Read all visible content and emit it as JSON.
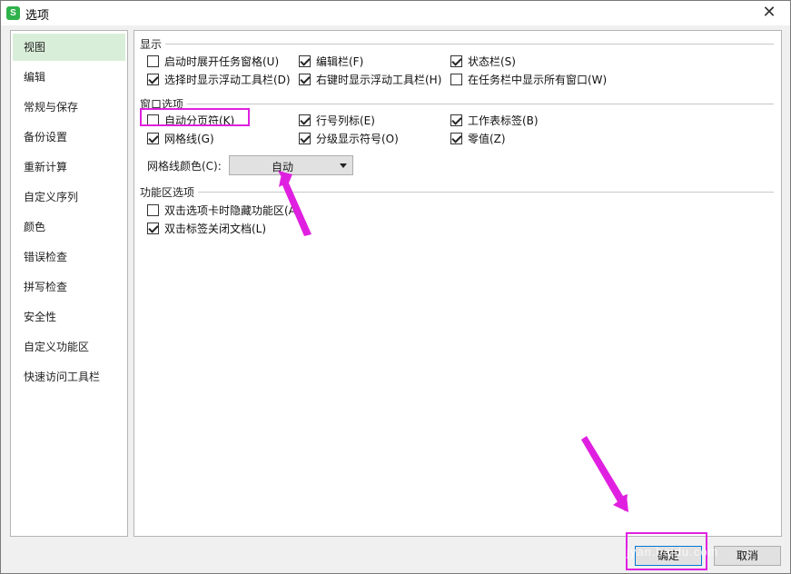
{
  "window": {
    "title": "选项",
    "app_logo": "S",
    "close_glyph": "✕"
  },
  "sidebar": {
    "items": [
      {
        "label": "视图",
        "active": true
      },
      {
        "label": "编辑"
      },
      {
        "label": "常规与保存"
      },
      {
        "label": "备份设置"
      },
      {
        "label": "重新计算"
      },
      {
        "label": "自定义序列"
      },
      {
        "label": "颜色"
      },
      {
        "label": "错误检查"
      },
      {
        "label": "拼写检查"
      },
      {
        "label": "安全性"
      },
      {
        "label": "自定义功能区"
      },
      {
        "label": "快速访问工具栏"
      }
    ]
  },
  "sections": {
    "display": {
      "title": "显示",
      "options": [
        {
          "label": "启动时展开任务窗格(U)",
          "checked": false
        },
        {
          "label": "编辑栏(F)",
          "checked": true
        },
        {
          "label": "状态栏(S)",
          "checked": true
        },
        {
          "label": "选择时显示浮动工具栏(D)",
          "checked": true
        },
        {
          "label": "右键时显示浮动工具栏(H)",
          "checked": true
        },
        {
          "label": "在任务栏中显示所有窗口(W)",
          "checked": false
        }
      ]
    },
    "window_options": {
      "title": "窗口选项",
      "options": [
        {
          "label": "自动分页符(K)",
          "checked": false
        },
        {
          "label": "行号列标(E)",
          "checked": true
        },
        {
          "label": "工作表标签(B)",
          "checked": true
        },
        {
          "label": "网格线(G)",
          "checked": true
        },
        {
          "label": "分级显示符号(O)",
          "checked": true
        },
        {
          "label": "零值(Z)",
          "checked": true
        }
      ],
      "grid_color_label": "网格线颜色(C):",
      "grid_color_value": "自动"
    },
    "ribbon_options": {
      "title": "功能区选项",
      "options": [
        {
          "label": "双击选项卡时隐藏功能区(A)",
          "checked": false
        },
        {
          "label": "双击标签关闭文档(L)",
          "checked": true
        }
      ]
    }
  },
  "buttons": {
    "ok": "确定",
    "cancel": "取消"
  },
  "annotation_color": "#e020e0",
  "watermark": "jyan.baidu.com"
}
